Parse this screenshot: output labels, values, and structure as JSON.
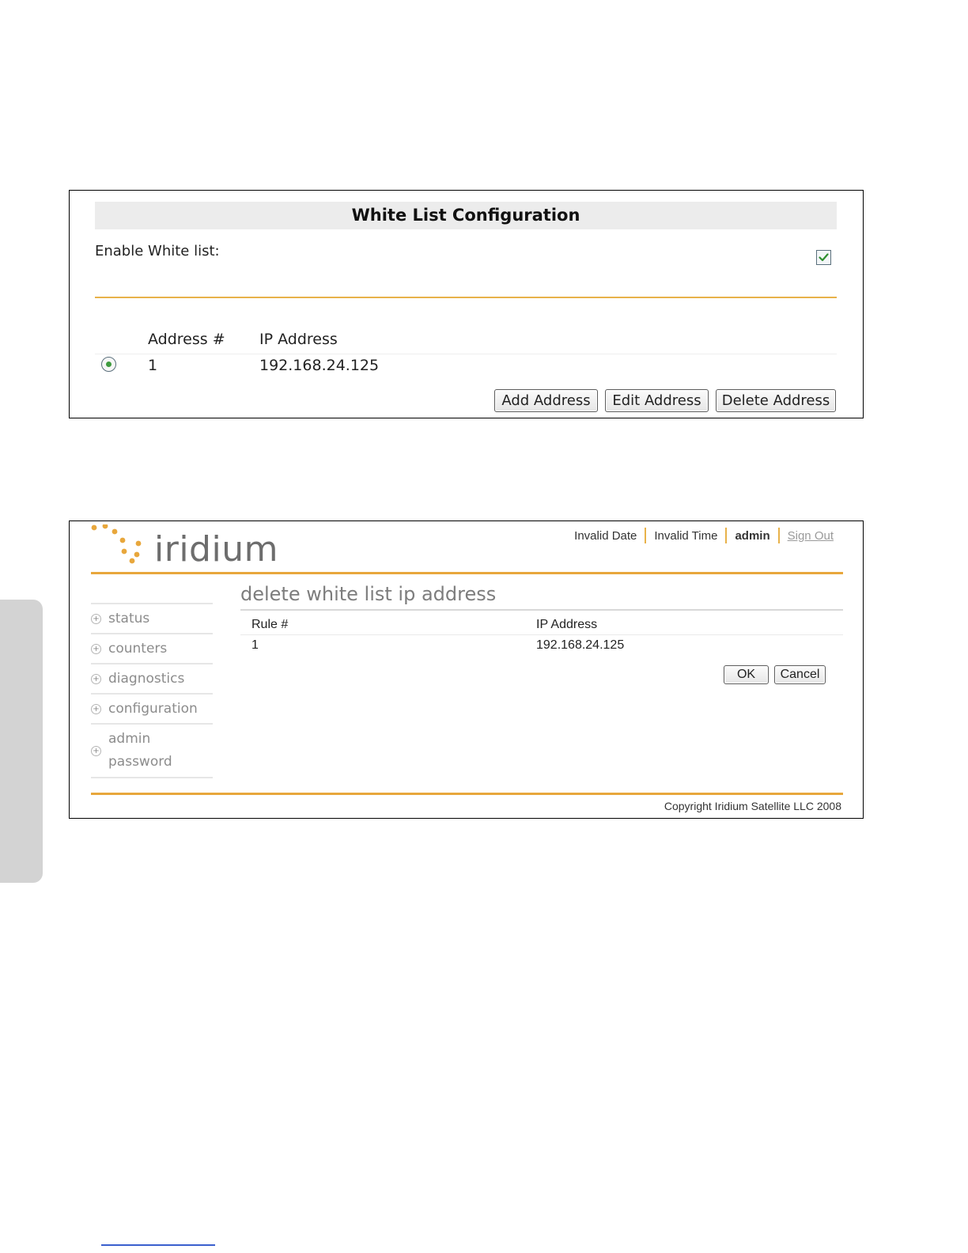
{
  "white_list_config": {
    "title": "White List Configuration",
    "enable_label": "Enable White list:",
    "enable_checked": true,
    "columns": {
      "address_num": "Address #",
      "ip_address": "IP Address"
    },
    "rows": [
      {
        "address_num": "1",
        "ip_address": "192.168.24.125",
        "selected": true
      }
    ],
    "buttons": {
      "add": "Add Address",
      "edit": "Edit Address",
      "delete": "Delete Address"
    }
  },
  "iridium_page": {
    "logo_text": "iridium",
    "accent_color": "#e8a73c",
    "top_nav": {
      "date": "Invalid Date",
      "time": "Invalid Time",
      "user": "admin",
      "sign_out": "Sign Out"
    },
    "sidebar": [
      {
        "label": "status"
      },
      {
        "label": "counters"
      },
      {
        "label": "diagnostics"
      },
      {
        "label": "configuration"
      },
      {
        "label_line1": "admin",
        "label_line2": "password"
      }
    ],
    "content_title": "delete white list ip address",
    "columns": {
      "rule": "Rule #",
      "ip_address": "IP Address"
    },
    "rows": [
      {
        "rule": "1",
        "ip_address": "192.168.24.125"
      }
    ],
    "buttons": {
      "ok": "OK",
      "cancel": "Cancel"
    },
    "copyright": "Copyright Iridium Satellite LLC 2008"
  }
}
